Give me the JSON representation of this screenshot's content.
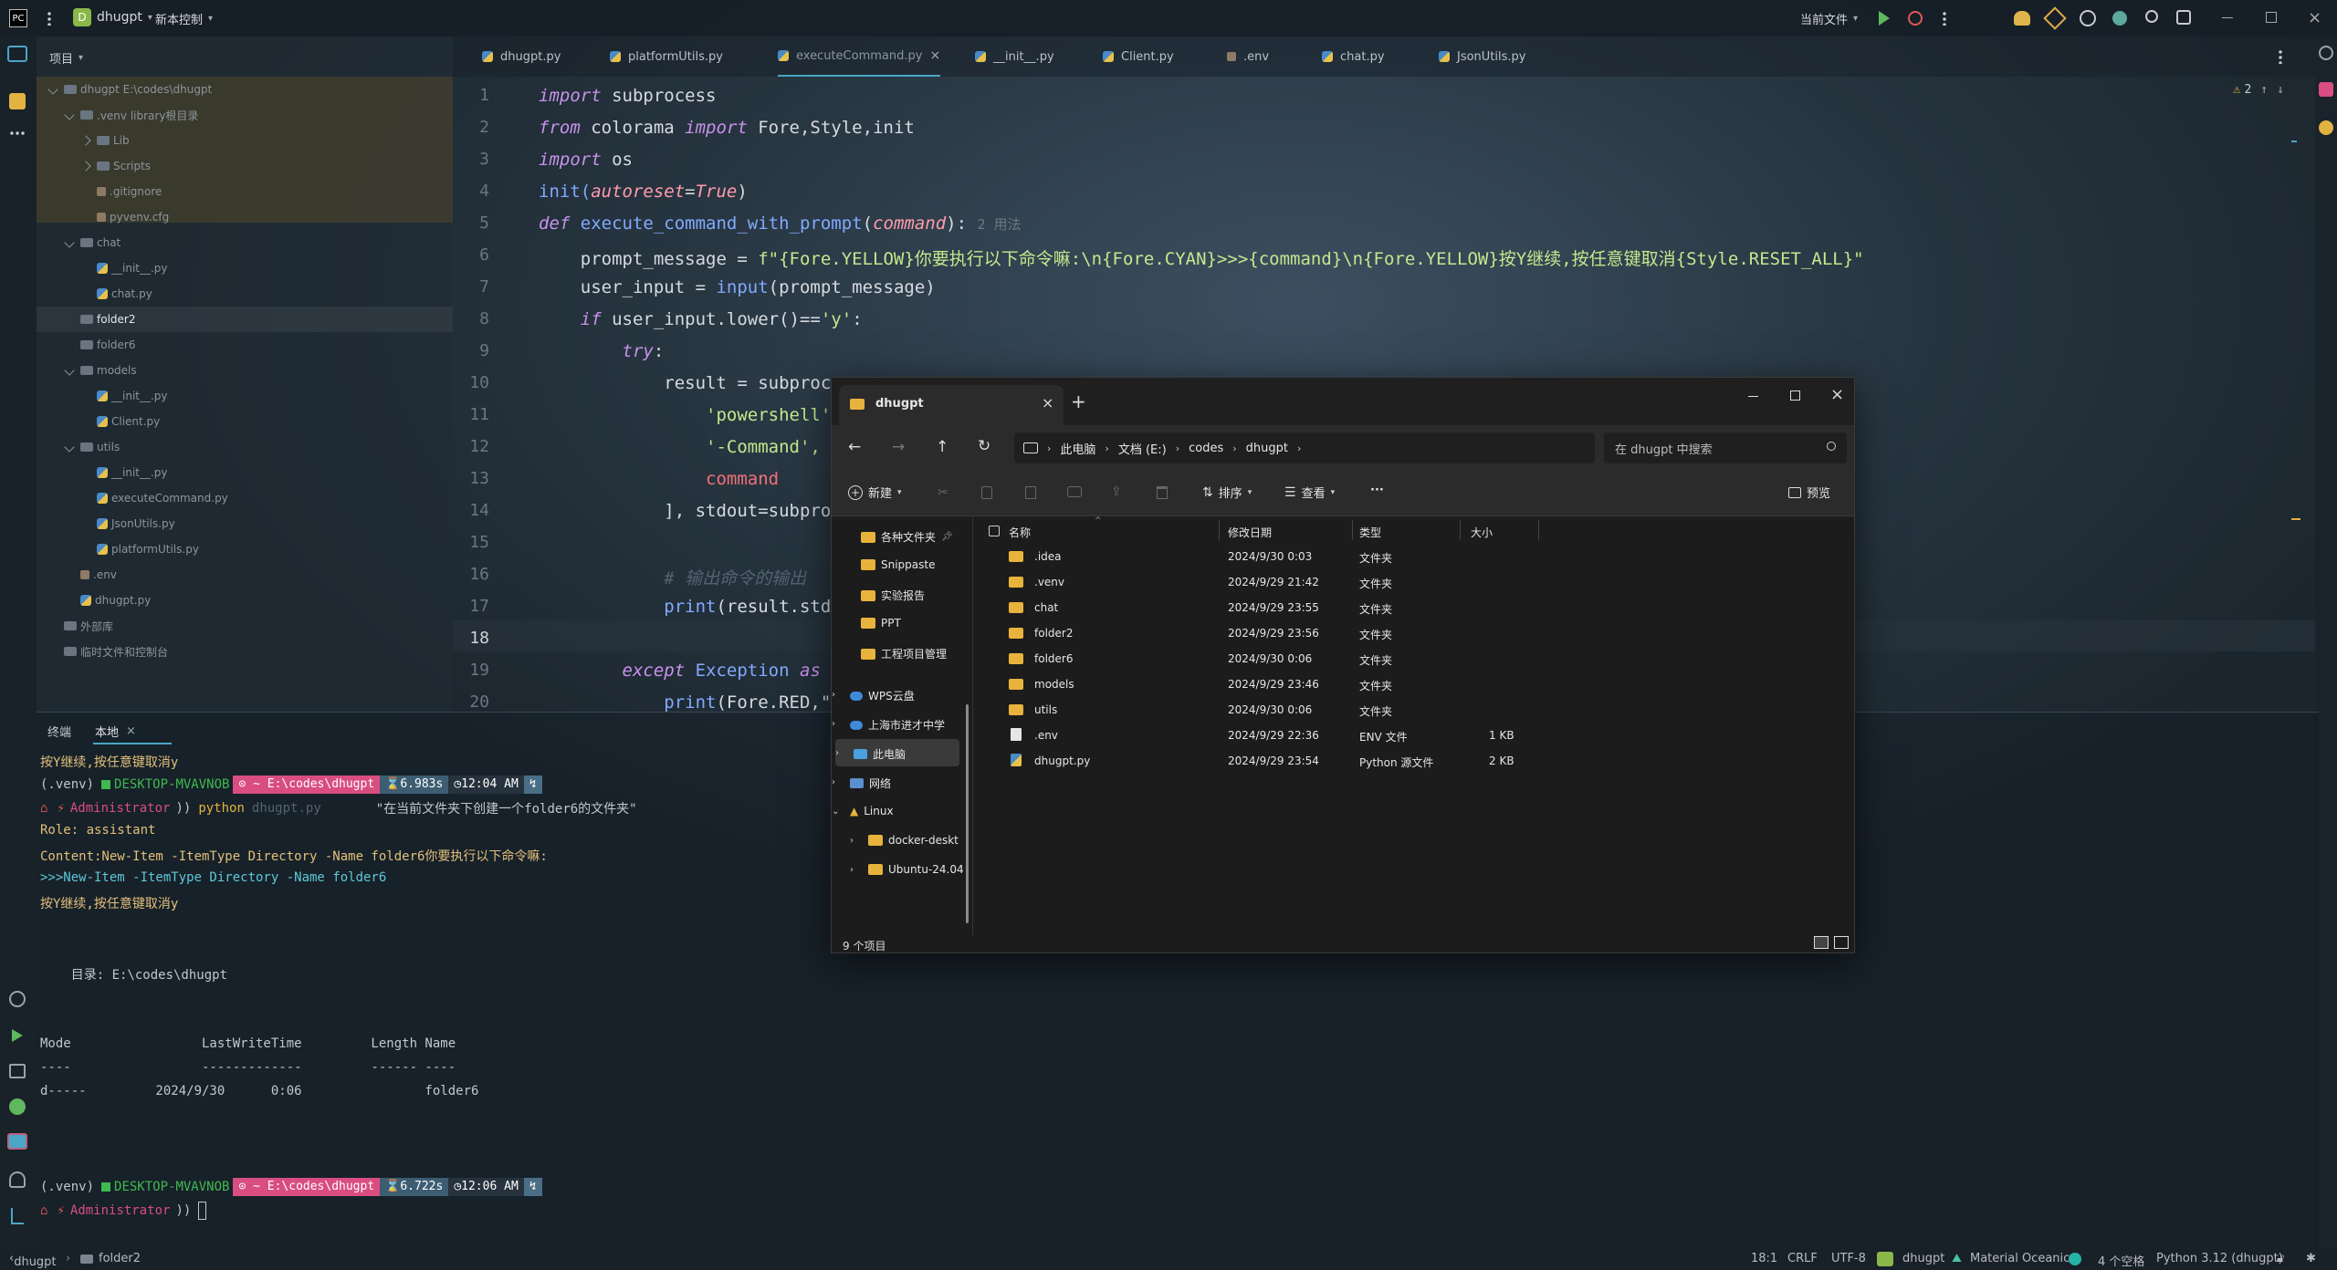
{
  "titlebar": {
    "project": "dhugpt",
    "vcs": "新本控制",
    "run_config": "当前文件"
  },
  "project_panel": {
    "header": "项目",
    "items": [
      {
        "label": "dhugpt  E:\\codes\\dhugpt",
        "depth": 0,
        "type": "folder",
        "open": true
      },
      {
        "label": ".venv  library根目录",
        "depth": 1,
        "type": "folder",
        "open": true
      },
      {
        "label": "Lib",
        "depth": 2,
        "type": "folder",
        "open": false
      },
      {
        "label": "Scripts",
        "depth": 2,
        "type": "folder",
        "open": false
      },
      {
        "label": ".gitignore",
        "depth": 2,
        "type": "cfg"
      },
      {
        "label": "pyvenv.cfg",
        "depth": 2,
        "type": "cfg"
      },
      {
        "label": "chat",
        "depth": 1,
        "type": "folder",
        "open": true
      },
      {
        "label": "__init__.py",
        "depth": 2,
        "type": "py"
      },
      {
        "label": "chat.py",
        "depth": 2,
        "type": "py"
      },
      {
        "label": "folder2",
        "depth": 1,
        "type": "folder",
        "selected": true
      },
      {
        "label": "folder6",
        "depth": 1,
        "type": "folder"
      },
      {
        "label": "models",
        "depth": 1,
        "type": "folder",
        "open": true
      },
      {
        "label": "__init__.py",
        "depth": 2,
        "type": "py"
      },
      {
        "label": "Client.py",
        "depth": 2,
        "type": "py"
      },
      {
        "label": "utils",
        "depth": 1,
        "type": "folder",
        "open": true
      },
      {
        "label": "__init__.py",
        "depth": 2,
        "type": "py"
      },
      {
        "label": "executeCommand.py",
        "depth": 2,
        "type": "py"
      },
      {
        "label": "JsonUtils.py",
        "depth": 2,
        "type": "py"
      },
      {
        "label": "platformUtils.py",
        "depth": 2,
        "type": "py"
      },
      {
        "label": ".env",
        "depth": 1,
        "type": "cfg"
      },
      {
        "label": "dhugpt.py",
        "depth": 1,
        "type": "py"
      },
      {
        "label": "外部库",
        "depth": 0,
        "type": "folder"
      },
      {
        "label": "临时文件和控制台",
        "depth": 0,
        "type": "folder"
      }
    ]
  },
  "tabs": [
    {
      "label": "dhugpt.py",
      "active": false
    },
    {
      "label": "platformUtils.py",
      "active": false
    },
    {
      "label": "executeCommand.py",
      "active": true
    },
    {
      "label": "__init__.py",
      "active": false
    },
    {
      "label": "Client.py",
      "active": false
    },
    {
      "label": ".env",
      "active": false
    },
    {
      "label": "chat.py",
      "active": false
    },
    {
      "label": "JsonUtils.py",
      "active": false
    }
  ],
  "editor": {
    "warnings": "2",
    "usage_hint": "2 用法",
    "line_numbers": [
      "1",
      "2",
      "3",
      "4",
      "5",
      "6",
      "7",
      "8",
      "9",
      "10",
      "11",
      "12",
      "13",
      "14",
      "15",
      "16",
      "17",
      "18",
      "19",
      "20"
    ],
    "code": {
      "l1a": "import",
      "l1b": " subprocess",
      "l2a": "from",
      "l2b": " colorama ",
      "l2c": "import",
      "l2d": " Fore,Style,init",
      "l3a": "import",
      "l3b": " os",
      "l4a": "init(",
      "l4b": "autoreset",
      "l4c": "=",
      "l4d": "True",
      ")": ")",
      "l5a": "def",
      "l5b": " execute_command_with_prompt",
      "l5c": "(",
      "l5d": "command",
      "l5e": "):",
      "l6a": "    prompt_message = ",
      "l6b": "f\"{Fore.YELLOW}你要执行以下命令嘛:\\n{Fore.CYAN}>>>{command}\\n{Fore.YELLOW}按Y继续,按任意键取消{Style.RESET_ALL}\"",
      "l7a": "    user_input = ",
      "l7b": "input",
      "l7c": "(prompt_message)",
      "l8a": "    if",
      "l8b": " user_input.lower()==",
      "l8c": "'y'",
      ":": ":",
      "l9a": "        try",
      "l10a": "            result = subproce",
      "l11a": "                'powershell',",
      "l12a": "                '-Command',",
      "l13a": "                command",
      "l14a": "            ], stdout=subproc",
      "l16a": "            # 输出命令的输出",
      "l17a": "            print",
      "l17b": "(result.stdo",
      "l19a": "        except",
      "l19b": " Exception ",
      "l19c": "as e",
      "l20a": "            print",
      "l20b": "(Fore.RED,\"E"
    }
  },
  "terminal": {
    "tab_label": "终端",
    "tab_local": "本地",
    "lines": {
      "l1": "按Y继续,按任意键取消y",
      "venv": "(.venv)",
      "host": "DESKTOP-MVAVNOB",
      "path": "E:\\codes\\dhugpt",
      "time1": "6.983s",
      "clock1": "12:04 AM",
      "user": "Administrator",
      "cmd": "python",
      "cmd_file": "dhugpt.py",
      "cmd_arg": "\"在当前文件夹下创建一个folder6的文件夹\"",
      "role": "Role: assistant",
      "content": "Content:New-Item -ItemType Directory -Name folder6你要执行以下命令嘛:",
      "prompt": ">>>New-Item -ItemType Directory -Name folder6",
      "confirm": "按Y继续,按任意键取消y",
      "dir": "    目录: E:\\codes\\dhugpt",
      "hdr": "Mode                 LastWriteTime         Length Name",
      "sep": "----                 -------------         ------ ----",
      "entry": "d-----         2024/9/30      0:06                folder6",
      "time2": "6.722s",
      "clock2": "12:06 AM"
    }
  },
  "explorer": {
    "tab_title": "dhugpt",
    "breadcrumb": [
      "此电脑",
      "文档 (E:)",
      "codes",
      "dhugpt"
    ],
    "search_placeholder": "在 dhugpt 中搜索",
    "toolbar": {
      "new": "新建",
      "sort": "排序",
      "view": "查看",
      "more": "···",
      "preview": "预览"
    },
    "nav": [
      {
        "label": "各种文件夹",
        "pinned": true,
        "type": "folder"
      },
      {
        "label": "Snippaste",
        "type": "folder"
      },
      {
        "label": "实验报告",
        "type": "folder"
      },
      {
        "label": "PPT",
        "type": "folder"
      },
      {
        "label": "工程项目管理",
        "type": "folder"
      },
      {
        "label": "WPS云盘",
        "type": "cloud"
      },
      {
        "label": "上海市进才中学",
        "type": "cloud"
      },
      {
        "label": "此电脑",
        "type": "pc",
        "selected": true
      },
      {
        "label": "网络",
        "type": "net"
      },
      {
        "label": "Linux",
        "type": "linux"
      },
      {
        "label": "docker-deskt",
        "type": "folder"
      },
      {
        "label": "Ubuntu-24.04",
        "type": "folder"
      }
    ],
    "columns": [
      "名称",
      "修改日期",
      "类型",
      "大小"
    ],
    "files": [
      {
        "name": ".idea",
        "date": "2024/9/30 0:03",
        "type": "文件夹",
        "size": "",
        "kind": "folder"
      },
      {
        "name": ".venv",
        "date": "2024/9/29 21:42",
        "type": "文件夹",
        "size": "",
        "kind": "folder"
      },
      {
        "name": "chat",
        "date": "2024/9/29 23:55",
        "type": "文件夹",
        "size": "",
        "kind": "folder"
      },
      {
        "name": "folder2",
        "date": "2024/9/29 23:56",
        "type": "文件夹",
        "size": "",
        "kind": "folder"
      },
      {
        "name": "folder6",
        "date": "2024/9/30 0:06",
        "type": "文件夹",
        "size": "",
        "kind": "folder"
      },
      {
        "name": "models",
        "date": "2024/9/29 23:46",
        "type": "文件夹",
        "size": "",
        "kind": "folder"
      },
      {
        "name": "utils",
        "date": "2024/9/30 0:06",
        "type": "文件夹",
        "size": "",
        "kind": "folder"
      },
      {
        "name": ".env",
        "date": "2024/9/29 22:36",
        "type": "ENV 文件",
        "size": "1 KB",
        "kind": "file"
      },
      {
        "name": "dhugpt.py",
        "date": "2024/9/29 23:54",
        "type": "Python 源文件",
        "size": "2 KB",
        "kind": "py"
      }
    ],
    "count": "9 个项目"
  },
  "statusbar": {
    "crumb_project": "dhugpt",
    "crumb_folder": "folder2",
    "position": "18:1",
    "eol": "CRLF",
    "encoding": "UTF-8",
    "project": "dhugpt",
    "theme": "Material Oceanic",
    "indent": "4 个空格",
    "interpreter": "Python 3.12 (dhugpt)"
  }
}
